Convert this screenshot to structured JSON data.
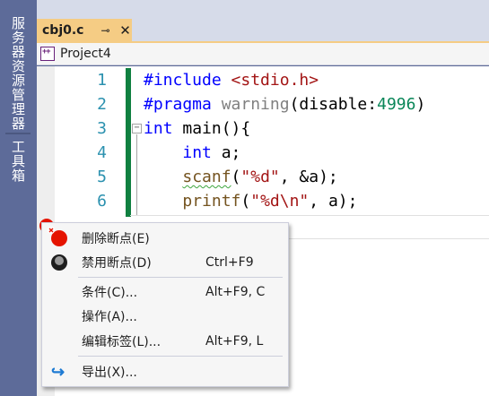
{
  "side_panel": {
    "tabs": [
      "服务器资源管理器",
      "工具箱"
    ]
  },
  "document_tab": {
    "title": "cbj0.c",
    "pin_glyph": "⊸",
    "close_glyph": "✕",
    "active_color": "#f5cc84"
  },
  "nav_bar": {
    "project": "Project4"
  },
  "editor": {
    "line_numbers": [
      "1",
      "2",
      "3",
      "4",
      "5",
      "6"
    ],
    "code": {
      "l1_directive": "#include",
      "l1_header": "<stdio.h>",
      "l2_directive": "#pragma",
      "l2_warning": "warning",
      "l2_open": "(disable:",
      "l2_num": "4996",
      "l2_close": ")",
      "l3_type": "int",
      "l3_rest": " main(){",
      "l4_type": "int",
      "l4_rest": " a;",
      "l5_fn": "scanf",
      "l5_open": "(",
      "l5_str": "\"%d\"",
      "l5_rest": ", &a);",
      "l6_fn": "printf",
      "l6_open": "(",
      "l6_str": "\"%d\\n\"",
      "l6_rest": ", a);"
    },
    "collapse_glyph": "−",
    "breakpoint_color": "#e51400"
  },
  "context_menu": {
    "items": [
      {
        "label": "删除断点(E)",
        "shortcut": "",
        "icon": "breakpoint-delete-icon"
      },
      {
        "label": "禁用断点(D)",
        "shortcut": "Ctrl+F9",
        "icon": "breakpoint-disable-icon"
      },
      {
        "label": "条件(C)...",
        "shortcut": "Alt+F9, C",
        "icon": ""
      },
      {
        "label": "操作(A)...",
        "shortcut": "",
        "icon": ""
      },
      {
        "label": "编辑标签(L)...",
        "shortcut": "Alt+F9, L",
        "icon": ""
      },
      {
        "label": "导出(X)...",
        "shortcut": "",
        "icon": "export-icon"
      }
    ],
    "export_glyph": "↪"
  }
}
